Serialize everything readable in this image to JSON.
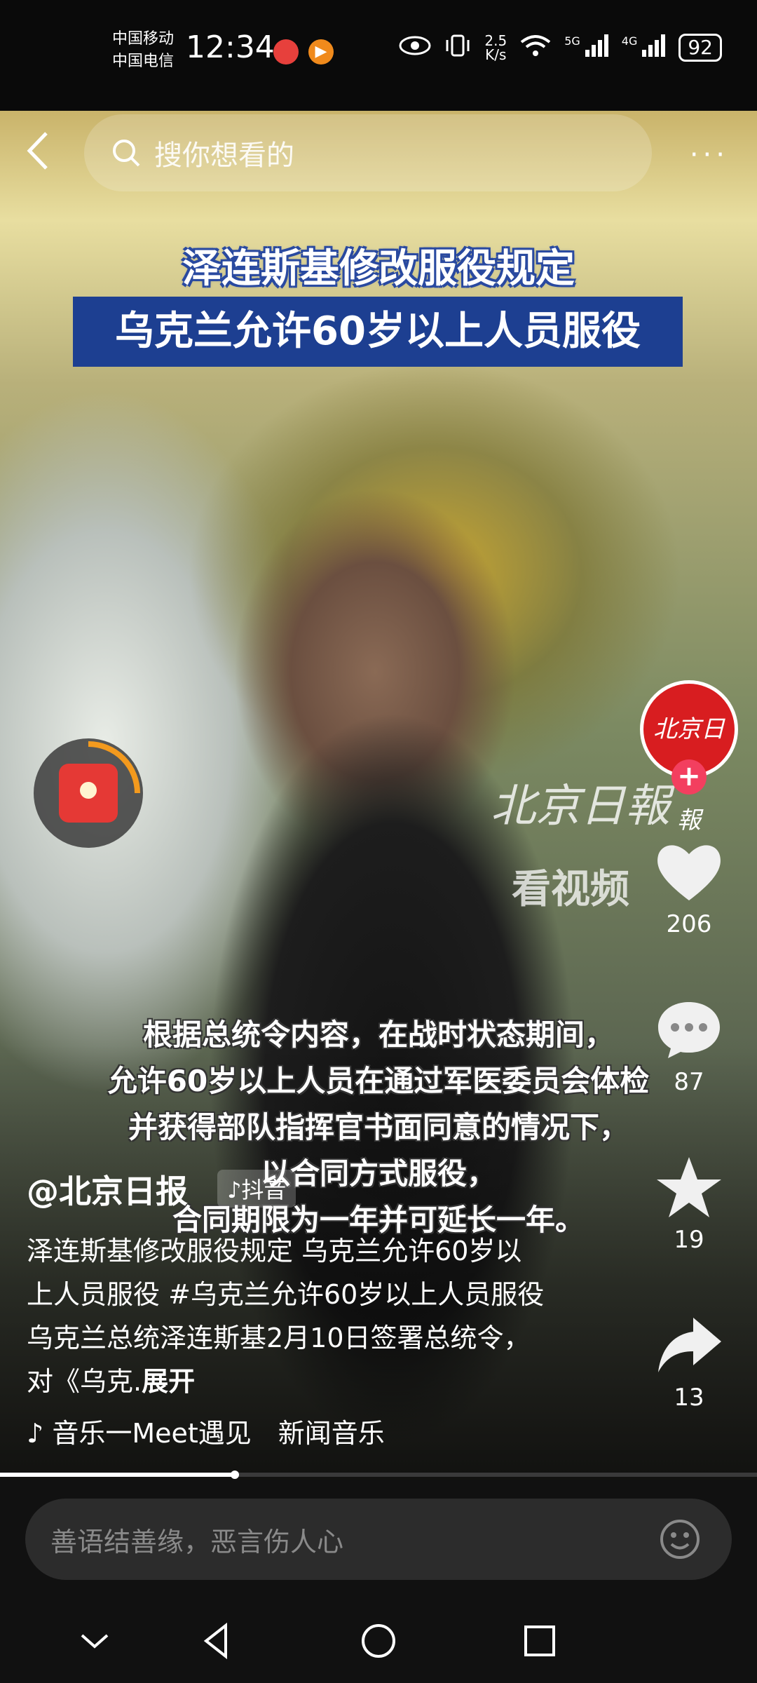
{
  "status": {
    "carrier1": "中国移动",
    "carrier2": "中国电信",
    "time": "12:34",
    "net_speed_value": "2.5",
    "net_speed_unit": "K/s",
    "sig1_label": "5G",
    "sig2_label": "4G",
    "battery": "92"
  },
  "top": {
    "search_placeholder": "搜你想看的",
    "more_label": "···"
  },
  "video": {
    "headline1": "泽连斯基修改服役规定",
    "headline2": "乌克兰允许60岁以上人员服役",
    "watermark": "北京日報",
    "watermark_sub": "看视频",
    "subtitles": [
      "根据总统令内容，在战时状态期间，",
      "允许60岁以上人员在通过军医委员会体检",
      "并获得部队指挥官书面同意的情况下，",
      "以合同方式服役，",
      "合同期限为一年并可延长一年。"
    ]
  },
  "rail": {
    "avatar_text": "北京日報",
    "follow": "+",
    "likes": "206",
    "comments": "87",
    "favorites": "19",
    "shares": "13"
  },
  "post": {
    "author": "@北京日报",
    "badge": "♪抖音",
    "description": "泽连斯基修改服役规定 乌克兰允许60岁以上人员服役 #乌克兰允许60岁以上人员服役乌克兰总统泽连斯基2月10日签署总统令，对《乌克.",
    "expand": "展开",
    "music": "♪ 音乐一Meet遇见　新闻音乐"
  },
  "playback": {
    "progress": 0.31
  },
  "comment": {
    "placeholder": "善语结善缘，恶言伤人心"
  },
  "colors": {
    "headline_bg": "#1d3f91",
    "avatar_bg": "#d81d20",
    "follow_plus": "#f33f5f",
    "redpacket": "#e53935",
    "ring": "#f39a1e"
  },
  "icons": [
    "back-arrow-icon",
    "search-icon",
    "more-icon",
    "heart-icon",
    "comment-icon",
    "star-icon",
    "share-icon",
    "emoji-icon",
    "nav-back-icon",
    "nav-home-icon",
    "nav-recents-icon",
    "nav-collapse-icon"
  ]
}
